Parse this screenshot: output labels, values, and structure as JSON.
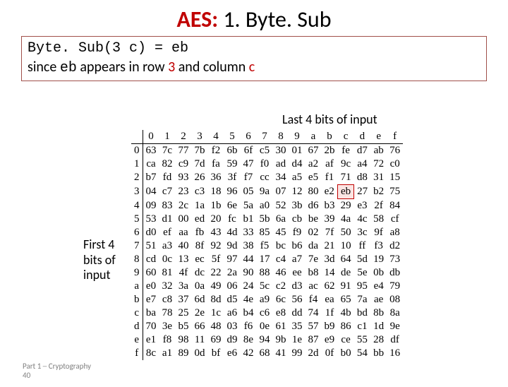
{
  "title": {
    "red": "AES:",
    "rest": " 1. Byte. Sub"
  },
  "box": {
    "l1a": "Byte. Sub(3 c) = eb",
    "l2a": "since ",
    "l2b": "eb",
    "l2c": " appears in row ",
    "l2d": "3",
    "l2e": " and column ",
    "l2f": "c"
  },
  "labels": {
    "top": "Last 4 bits of input",
    "left1": "First 4",
    "left2": "bits of",
    "left3": "input"
  },
  "footer": {
    "l1": "Part 1 ─ Cryptography",
    "l2": "40"
  },
  "cols": [
    "0",
    "1",
    "2",
    "3",
    "4",
    "5",
    "6",
    "7",
    "8",
    "9",
    "a",
    "b",
    "c",
    "d",
    "e",
    "f"
  ],
  "rows": [
    "0",
    "1",
    "2",
    "3",
    "4",
    "5",
    "6",
    "7",
    "8",
    "9",
    "a",
    "b",
    "c",
    "d",
    "e",
    "f"
  ],
  "sbox": [
    [
      "63",
      "7c",
      "77",
      "7b",
      "f2",
      "6b",
      "6f",
      "c5",
      "30",
      "01",
      "67",
      "2b",
      "fe",
      "d7",
      "ab",
      "76"
    ],
    [
      "ca",
      "82",
      "c9",
      "7d",
      "fa",
      "59",
      "47",
      "f0",
      "ad",
      "d4",
      "a2",
      "af",
      "9c",
      "a4",
      "72",
      "c0"
    ],
    [
      "b7",
      "fd",
      "93",
      "26",
      "36",
      "3f",
      "f7",
      "cc",
      "34",
      "a5",
      "e5",
      "f1",
      "71",
      "d8",
      "31",
      "15"
    ],
    [
      "04",
      "c7",
      "23",
      "c3",
      "18",
      "96",
      "05",
      "9a",
      "07",
      "12",
      "80",
      "e2",
      "eb",
      "27",
      "b2",
      "75"
    ],
    [
      "09",
      "83",
      "2c",
      "1a",
      "1b",
      "6e",
      "5a",
      "a0",
      "52",
      "3b",
      "d6",
      "b3",
      "29",
      "e3",
      "2f",
      "84"
    ],
    [
      "53",
      "d1",
      "00",
      "ed",
      "20",
      "fc",
      "b1",
      "5b",
      "6a",
      "cb",
      "be",
      "39",
      "4a",
      "4c",
      "58",
      "cf"
    ],
    [
      "d0",
      "ef",
      "aa",
      "fb",
      "43",
      "4d",
      "33",
      "85",
      "45",
      "f9",
      "02",
      "7f",
      "50",
      "3c",
      "9f",
      "a8"
    ],
    [
      "51",
      "a3",
      "40",
      "8f",
      "92",
      "9d",
      "38",
      "f5",
      "bc",
      "b6",
      "da",
      "21",
      "10",
      "ff",
      "f3",
      "d2"
    ],
    [
      "cd",
      "0c",
      "13",
      "ec",
      "5f",
      "97",
      "44",
      "17",
      "c4",
      "a7",
      "7e",
      "3d",
      "64",
      "5d",
      "19",
      "73"
    ],
    [
      "60",
      "81",
      "4f",
      "dc",
      "22",
      "2a",
      "90",
      "88",
      "46",
      "ee",
      "b8",
      "14",
      "de",
      "5e",
      "0b",
      "db"
    ],
    [
      "e0",
      "32",
      "3a",
      "0a",
      "49",
      "06",
      "24",
      "5c",
      "c2",
      "d3",
      "ac",
      "62",
      "91",
      "95",
      "e4",
      "79"
    ],
    [
      "e7",
      "c8",
      "37",
      "6d",
      "8d",
      "d5",
      "4e",
      "a9",
      "6c",
      "56",
      "f4",
      "ea",
      "65",
      "7a",
      "ae",
      "08"
    ],
    [
      "ba",
      "78",
      "25",
      "2e",
      "1c",
      "a6",
      "b4",
      "c6",
      "e8",
      "dd",
      "74",
      "1f",
      "4b",
      "bd",
      "8b",
      "8a"
    ],
    [
      "70",
      "3e",
      "b5",
      "66",
      "48",
      "03",
      "f6",
      "0e",
      "61",
      "35",
      "57",
      "b9",
      "86",
      "c1",
      "1d",
      "9e"
    ],
    [
      "e1",
      "f8",
      "98",
      "11",
      "69",
      "d9",
      "8e",
      "94",
      "9b",
      "1e",
      "87",
      "e9",
      "ce",
      "55",
      "28",
      "df"
    ],
    [
      "8c",
      "a1",
      "89",
      "0d",
      "bf",
      "e6",
      "42",
      "68",
      "41",
      "99",
      "2d",
      "0f",
      "b0",
      "54",
      "bb",
      "16"
    ]
  ],
  "highlight": {
    "row": 3,
    "col": 12
  },
  "chart_data": {
    "type": "table",
    "title": "AES S-box (ByteSub)",
    "xlabel": "Last 4 bits of input",
    "ylabel": "First 4 bits of input",
    "columns": [
      "0",
      "1",
      "2",
      "3",
      "4",
      "5",
      "6",
      "7",
      "8",
      "9",
      "a",
      "b",
      "c",
      "d",
      "e",
      "f"
    ],
    "rows": [
      "0",
      "1",
      "2",
      "3",
      "4",
      "5",
      "6",
      "7",
      "8",
      "9",
      "a",
      "b",
      "c",
      "d",
      "e",
      "f"
    ],
    "values": [
      [
        "63",
        "7c",
        "77",
        "7b",
        "f2",
        "6b",
        "6f",
        "c5",
        "30",
        "01",
        "67",
        "2b",
        "fe",
        "d7",
        "ab",
        "76"
      ],
      [
        "ca",
        "82",
        "c9",
        "7d",
        "fa",
        "59",
        "47",
        "f0",
        "ad",
        "d4",
        "a2",
        "af",
        "9c",
        "a4",
        "72",
        "c0"
      ],
      [
        "b7",
        "fd",
        "93",
        "26",
        "36",
        "3f",
        "f7",
        "cc",
        "34",
        "a5",
        "e5",
        "f1",
        "71",
        "d8",
        "31",
        "15"
      ],
      [
        "04",
        "c7",
        "23",
        "c3",
        "18",
        "96",
        "05",
        "9a",
        "07",
        "12",
        "80",
        "e2",
        "eb",
        "27",
        "b2",
        "75"
      ],
      [
        "09",
        "83",
        "2c",
        "1a",
        "1b",
        "6e",
        "5a",
        "a0",
        "52",
        "3b",
        "d6",
        "b3",
        "29",
        "e3",
        "2f",
        "84"
      ],
      [
        "53",
        "d1",
        "00",
        "ed",
        "20",
        "fc",
        "b1",
        "5b",
        "6a",
        "cb",
        "be",
        "39",
        "4a",
        "4c",
        "58",
        "cf"
      ],
      [
        "d0",
        "ef",
        "aa",
        "fb",
        "43",
        "4d",
        "33",
        "85",
        "45",
        "f9",
        "02",
        "7f",
        "50",
        "3c",
        "9f",
        "a8"
      ],
      [
        "51",
        "a3",
        "40",
        "8f",
        "92",
        "9d",
        "38",
        "f5",
        "bc",
        "b6",
        "da",
        "21",
        "10",
        "ff",
        "f3",
        "d2"
      ],
      [
        "cd",
        "0c",
        "13",
        "ec",
        "5f",
        "97",
        "44",
        "17",
        "c4",
        "a7",
        "7e",
        "3d",
        "64",
        "5d",
        "19",
        "73"
      ],
      [
        "60",
        "81",
        "4f",
        "dc",
        "22",
        "2a",
        "90",
        "88",
        "46",
        "ee",
        "b8",
        "14",
        "de",
        "5e",
        "0b",
        "db"
      ],
      [
        "e0",
        "32",
        "3a",
        "0a",
        "49",
        "06",
        "24",
        "5c",
        "c2",
        "d3",
        "ac",
        "62",
        "91",
        "95",
        "e4",
        "79"
      ],
      [
        "e7",
        "c8",
        "37",
        "6d",
        "8d",
        "d5",
        "4e",
        "a9",
        "6c",
        "56",
        "f4",
        "ea",
        "65",
        "7a",
        "ae",
        "08"
      ],
      [
        "ba",
        "78",
        "25",
        "2e",
        "1c",
        "a6",
        "b4",
        "c6",
        "e8",
        "dd",
        "74",
        "1f",
        "4b",
        "bd",
        "8b",
        "8a"
      ],
      [
        "70",
        "3e",
        "b5",
        "66",
        "48",
        "03",
        "f6",
        "0e",
        "61",
        "35",
        "57",
        "b9",
        "86",
        "c1",
        "1d",
        "9e"
      ],
      [
        "e1",
        "f8",
        "98",
        "11",
        "69",
        "d9",
        "8e",
        "94",
        "9b",
        "1e",
        "87",
        "e9",
        "ce",
        "55",
        "28",
        "df"
      ],
      [
        "8c",
        "a1",
        "89",
        "0d",
        "bf",
        "e6",
        "42",
        "68",
        "41",
        "99",
        "2d",
        "0f",
        "b0",
        "54",
        "bb",
        "16"
      ]
    ],
    "annotations": [
      {
        "text": "eb",
        "row": "3",
        "col": "c"
      }
    ]
  }
}
